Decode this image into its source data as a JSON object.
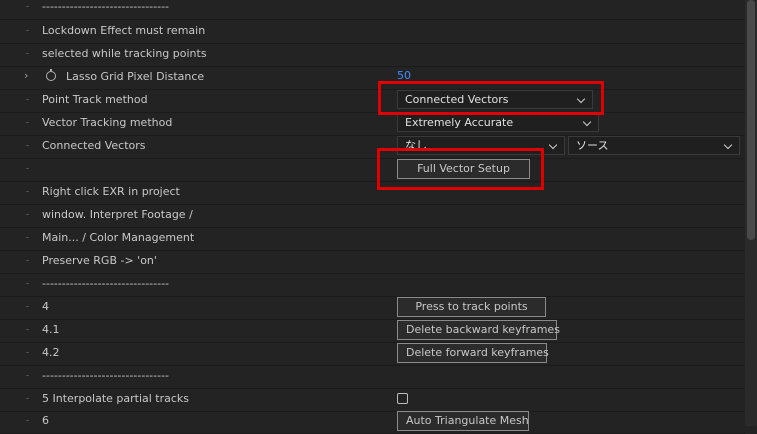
{
  "rows": {
    "r0": "--------------------------------",
    "r1": "Lockdown Effect must remain",
    "r2": "selected while tracking points",
    "r3": "Lasso Grid Pixel Distance",
    "r4": "Point Track method",
    "r5": "Vector Tracking method",
    "r6": "Connected Vectors",
    "r8": "Right click EXR in project",
    "r9": "window. Interpret Footage /",
    "r10": "Main... / Color Management",
    "r11": "Preserve RGB -> 'on'",
    "r12": "--------------------------------",
    "r13": "4",
    "r14": "4.1",
    "r15": "4.2",
    "r16": "--------------------------------",
    "r17": "5 Interpolate partial tracks",
    "r18": "6"
  },
  "values": {
    "lasso_grid_pixel_distance": "50",
    "point_track_method": "Connected Vectors",
    "vector_tracking_method": "Extremely Accurate",
    "connected_vectors_layer": "なし",
    "connected_vectors_source": "ソース"
  },
  "buttons": {
    "full_vector_setup": "Full Vector Setup",
    "press_to_track": "Press to track points",
    "delete_backward": "Delete backward keyframes",
    "delete_forward": "Delete forward keyframes",
    "auto_triangulate": "Auto Triangulate Mesh"
  },
  "colors": {
    "highlight": "#e00000",
    "value_link": "#3d8cff"
  }
}
